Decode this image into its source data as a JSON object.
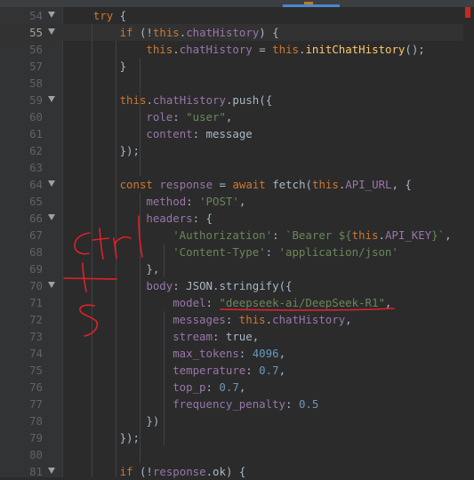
{
  "colors": {
    "background": "#2b2b2b",
    "gutter": "#313335",
    "keyword": "#cc7832",
    "string": "#6a8759",
    "number": "#6897bb",
    "field": "#9876aa",
    "function": "#ffc66d",
    "text": "#a9b7c6",
    "annotation_ink": "#e0202a"
  },
  "editor": {
    "active_line": 55,
    "lines": [
      {
        "n": "54",
        "fold": true,
        "segs": [
          [
            "kw",
            "try"
          ],
          [
            "t",
            " {"
          ]
        ]
      },
      {
        "n": "55",
        "fold": true,
        "segs": [
          [
            "kw",
            "if"
          ],
          [
            "t",
            " (!"
          ],
          [
            "kw",
            "this"
          ],
          [
            "t",
            "."
          ],
          [
            "fld",
            "chatHistory"
          ],
          [
            "t",
            ") {"
          ]
        ]
      },
      {
        "n": "56",
        "fold": false,
        "segs": [
          [
            "kw",
            "this"
          ],
          [
            "t",
            "."
          ],
          [
            "fld",
            "chatHistory"
          ],
          [
            "t",
            " = "
          ],
          [
            "kw",
            "this"
          ],
          [
            "t",
            "."
          ],
          [
            "fn",
            "initChatHistory"
          ],
          [
            "t",
            "();"
          ]
        ]
      },
      {
        "n": "57",
        "fold": false,
        "segs": [
          [
            "t",
            "}"
          ]
        ]
      },
      {
        "n": "58",
        "fold": false,
        "segs": []
      },
      {
        "n": "59",
        "fold": true,
        "segs": [
          [
            "kw",
            "this"
          ],
          [
            "t",
            "."
          ],
          [
            "fld",
            "chatHistory"
          ],
          [
            "t",
            ".push({"
          ]
        ]
      },
      {
        "n": "60",
        "fold": false,
        "segs": [
          [
            "prop",
            "role"
          ],
          [
            "t",
            ": "
          ],
          [
            "str",
            "\"user\""
          ],
          [
            "t",
            ","
          ]
        ]
      },
      {
        "n": "61",
        "fold": false,
        "segs": [
          [
            "prop",
            "content"
          ],
          [
            "t",
            ": message"
          ]
        ]
      },
      {
        "n": "62",
        "fold": false,
        "segs": [
          [
            "t",
            "});"
          ]
        ]
      },
      {
        "n": "63",
        "fold": false,
        "segs": []
      },
      {
        "n": "64",
        "fold": true,
        "segs": [
          [
            "kw",
            "const"
          ],
          [
            "t",
            " "
          ],
          [
            "fld",
            "response"
          ],
          [
            "t",
            " = "
          ],
          [
            "kw",
            "await"
          ],
          [
            "t",
            " fetch("
          ],
          [
            "kw",
            "this"
          ],
          [
            "t",
            "."
          ],
          [
            "fld",
            "API_URL"
          ],
          [
            "t",
            ", {"
          ]
        ]
      },
      {
        "n": "65",
        "fold": false,
        "segs": [
          [
            "prop",
            "method"
          ],
          [
            "t",
            ": "
          ],
          [
            "str",
            "'POST'"
          ],
          [
            "t",
            ","
          ]
        ]
      },
      {
        "n": "66",
        "fold": true,
        "segs": [
          [
            "prop",
            "headers"
          ],
          [
            "t",
            ": {"
          ]
        ]
      },
      {
        "n": "67",
        "fold": false,
        "segs": [
          [
            "str",
            "'Authorization'"
          ],
          [
            "t",
            ": "
          ],
          [
            "str",
            "`Bearer ${"
          ],
          [
            "kw",
            "this"
          ],
          [
            "t",
            "."
          ],
          [
            "fld",
            "API_KEY"
          ],
          [
            "str",
            "}`"
          ],
          [
            "t",
            ","
          ]
        ]
      },
      {
        "n": "68",
        "fold": false,
        "segs": [
          [
            "str",
            "'Content-Type'"
          ],
          [
            "t",
            ": "
          ],
          [
            "str",
            "'application/json'"
          ]
        ]
      },
      {
        "n": "69",
        "fold": false,
        "segs": [
          [
            "t",
            "},"
          ]
        ]
      },
      {
        "n": "70",
        "fold": true,
        "segs": [
          [
            "prop",
            "body"
          ],
          [
            "t",
            ": JSON.stringify({"
          ]
        ]
      },
      {
        "n": "71",
        "fold": false,
        "segs": [
          [
            "prop",
            "model"
          ],
          [
            "t",
            ": "
          ],
          [
            "str",
            "\"deepseek-ai/DeepSeek-R1\""
          ],
          [
            "t",
            ","
          ]
        ]
      },
      {
        "n": "72",
        "fold": false,
        "segs": [
          [
            "prop",
            "messages"
          ],
          [
            "t",
            ": "
          ],
          [
            "kw",
            "this"
          ],
          [
            "t",
            "."
          ],
          [
            "fld",
            "chatHistory"
          ],
          [
            "t",
            ","
          ]
        ]
      },
      {
        "n": "73",
        "fold": false,
        "segs": [
          [
            "prop",
            "stream"
          ],
          [
            "t",
            ": true,"
          ]
        ]
      },
      {
        "n": "74",
        "fold": false,
        "segs": [
          [
            "prop",
            "max_tokens"
          ],
          [
            "t",
            ": "
          ],
          [
            "num",
            "4096"
          ],
          [
            "t",
            ","
          ]
        ]
      },
      {
        "n": "75",
        "fold": false,
        "segs": [
          [
            "prop",
            "temperature"
          ],
          [
            "t",
            ": "
          ],
          [
            "num",
            "0.7"
          ],
          [
            "t",
            ","
          ]
        ]
      },
      {
        "n": "76",
        "fold": false,
        "segs": [
          [
            "prop",
            "top_p"
          ],
          [
            "t",
            ": "
          ],
          [
            "num",
            "0.7"
          ],
          [
            "t",
            ","
          ]
        ]
      },
      {
        "n": "77",
        "fold": false,
        "segs": [
          [
            "prop",
            "frequency_penalty"
          ],
          [
            "t",
            ": "
          ],
          [
            "num",
            "0.5"
          ]
        ]
      },
      {
        "n": "78",
        "fold": false,
        "segs": [
          [
            "t",
            "})"
          ]
        ]
      },
      {
        "n": "79",
        "fold": false,
        "segs": [
          [
            "t",
            "});"
          ]
        ]
      },
      {
        "n": "80",
        "fold": false,
        "segs": []
      },
      {
        "n": "81",
        "fold": true,
        "segs": [
          [
            "kw",
            "if"
          ],
          [
            "t",
            " (!"
          ],
          [
            "fld",
            "response"
          ],
          [
            "t",
            ".ok) {"
          ]
        ]
      }
    ]
  },
  "annotation": {
    "kind": "handwritten",
    "color": "#e0202a"
  }
}
